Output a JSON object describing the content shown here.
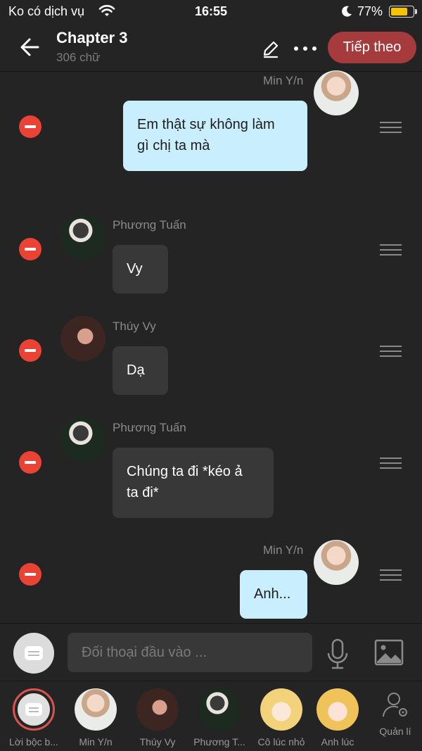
{
  "status_bar": {
    "carrier": "Ko có dịch vụ",
    "time": "16:55",
    "battery": "77%",
    "battery_level": 0.77
  },
  "header": {
    "title": "Chapter 3",
    "subtitle": "306 chữ",
    "next_label": "Tiếp theo"
  },
  "messages": [
    {
      "sender": "Min Y/n",
      "text": [
        "Em thật sự không làm",
        "gì chị ta mà"
      ],
      "side": "right"
    },
    {
      "sender": "Phương Tuấn",
      "text": [
        "Vy"
      ],
      "side": "left"
    },
    {
      "sender": "Thúy Vy",
      "text": [
        "Dạ"
      ],
      "side": "left"
    },
    {
      "sender": "Phương Tuấn",
      "text": [
        "Chúng ta đi *kéo ả",
        "ta đi*"
      ],
      "side": "left"
    },
    {
      "sender": "Min Y/n",
      "text": [
        "Anh..."
      ],
      "side": "right"
    }
  ],
  "input": {
    "placeholder": "Đối thoại đầu vào ..."
  },
  "characters": [
    {
      "name": "Lời bộc b..."
    },
    {
      "name": "Min Y/n"
    },
    {
      "name": "Thúy Vy"
    },
    {
      "name": "Phương T..."
    },
    {
      "name": "Cô lúc nhỏ"
    },
    {
      "name": "Anh lúc"
    }
  ],
  "manage_label": "Quản lí",
  "colors": {
    "accent": "#a53b3c",
    "my_bubble": "#c9eefe",
    "their_bubble": "#383838",
    "remove": "#ea4335"
  }
}
